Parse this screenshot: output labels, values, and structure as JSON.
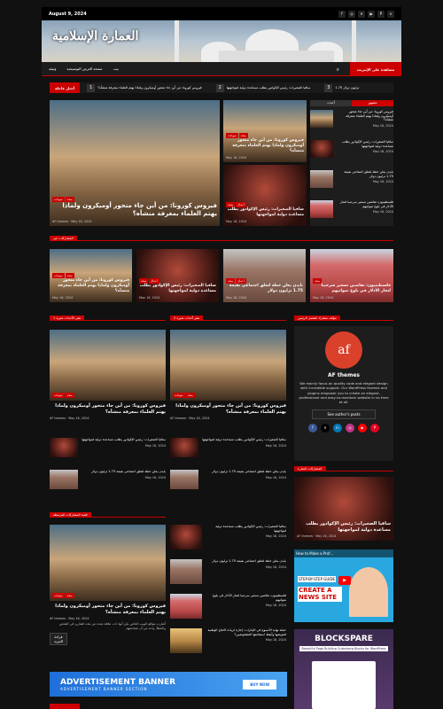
{
  "topbar": {
    "date": "August 9, 2024",
    "social_icons": [
      "facebook-icon",
      "instagram-icon",
      "x-icon",
      "youtube-icon",
      "pinterest-icon",
      "vk-icon"
    ]
  },
  "site": {
    "title": "العمارة الإسلامية"
  },
  "nav": {
    "live_label": "مشاهدة على الإنترنت",
    "items": [
      "بيت",
      "صفحة العرض التوضيحية",
      "وثيقة"
    ]
  },
  "ticker": {
    "label": "أخبار عاجلة",
    "items": [
      {
        "num": "1",
        "text": "فيروس كورونا: من أين جاء متحور أوميكرون ولماذا يهتم العلماء بمعرفة منشأه؟"
      },
      {
        "num": "2",
        "text": "سافيا الصغيرات: رئيس الإكوادور يطلب مساعدة دولية لمواجهتها"
      },
      {
        "num": "3",
        "text": "1.75 ترليون دولار"
      }
    ]
  },
  "hero": {
    "main": {
      "cats": [
        "منوعات",
        "صحة"
      ],
      "title": "فيروس كورونا: من أين جاء متحور أوميكرون ولماذا يهتم العلماء بمعرفة منشأه؟",
      "author": "AF themes",
      "date": "May 16, 2024"
    },
    "side1": {
      "cats": [
        "منوعات",
        "صحة"
      ],
      "title": "فيروس كورونا: من أين جاء متحور أوميكرون ولماذا يهتم العلماء بمعرفة منشأه؟",
      "date": "May 16, 2024"
    },
    "side2": {
      "cats": [
        "صحة",
        "أعمال"
      ],
      "title": "سافيا الصغيرات: رئيس الإكوادور يطلب مساعدة دولية لمواجهتها",
      "date": "May 16, 2024"
    }
  },
  "tabs": {
    "tab1": "مشهور",
    "tab2": "أحدث"
  },
  "tab_list": [
    {
      "title": "فيروس كورونا: من أين جاء متحور أوميكرون ولماذا يهتم العلماء بمعرفة منشأه؟",
      "date": "May 16, 2024"
    },
    {
      "title": "سافيا الصغيرات: رئيس الإكوادور يطلب مساعدة دولية لمواجهتها",
      "date": "May 16, 2024"
    },
    {
      "title": "بايدن يعلن خطة لتغلق اجتماعي بقيمة 1.75 ترليون دولار",
      "date": "May 16, 2024"
    },
    {
      "title": "فلسطينيون: تقاضين تسعير سرحيبا لتجار الأدلار في بلوغ تموانيهم",
      "date": "May 16, 2024"
    }
  ],
  "featured": {
    "heading": "المشاركات عبر",
    "items": [
      {
        "cats": [
          "منوعات",
          "صحة"
        ],
        "title": "فيروس كورونا: من أين جاء متحور أوميكرون ولماذا يهتم العلماء بمعرفة منشأه؟",
        "date": "May 16, 2024"
      },
      {
        "cats": [
          "صحة",
          "أعمال"
        ],
        "title": "سافيا الصغيرات: رئيس الإكوادور يطلب مساعدة دولية لمواجهتها",
        "date": "May 16, 2024"
      },
      {
        "cats": [
          "صحة",
          "أعمال"
        ],
        "title": "بايدن يعلن خطة لتغلق اجتماعي بقيمة 1.75 ترليون دولار",
        "date": "May 16, 2024"
      },
      {
        "cats": [
          "صحة"
        ],
        "title": "فلسطينيون: تقاضين تسعير سرحيبا لتجار الأدلار في بلوغ تموانيهم",
        "date": "May 16, 2024"
      }
    ]
  },
  "col_left": {
    "heading": "نشر الأحداث مثيرة 1",
    "main_title": "فيروس كورونا: من أين جاء متحور أوميكرون ولماذا يهتم العلماء بمعرفة منشأه؟",
    "author": "AF themes",
    "date": "May 16, 2024",
    "list": [
      {
        "title": "سافيا الصغيرات: رئيس الإكوادور يطلب مساعدة دولية لمواجهتها",
        "date": "May 16, 2024"
      },
      {
        "title": "بايدن يعلن خطة لتغلق اجتماعي بقيمة 1.75 ترليون دولار",
        "date": "May 16, 2024"
      }
    ]
  },
  "col_right": {
    "heading": "نشر أحداث مثيرة 2",
    "main_title": "فيروس كورونا: من أين جاء متحور أوميكرون ولماذا يهتم العلماء بمعرفة منشأه؟",
    "author": "AF themes",
    "date": "May 16, 2024",
    "list": [
      {
        "title": "سافيا الصغيرات: رئيس الإكوادور يطلب مساعدة دولية لمواجهتها",
        "date": "May 16, 2024"
      },
      {
        "title": "بايدن يعلن خطة لتغلق اجتماعي بقيمة 1.75 ترليون دولار",
        "date": "May 16, 2024"
      }
    ]
  },
  "author_box": {
    "heading": "مؤلف مشارك للفصل الرئيس",
    "name": "AF themes",
    "bio": "We mainly focus on quality code and elegant design with incredible support. Our WordPress themes and plugins empower you to create an elegant, professional and easy-to-maintain website in no time at all.",
    "button": "See author's posts"
  },
  "featured_side": {
    "heading": "المشاركات المثارة",
    "title": "سافيا الصغيرات: رئيس الإكوادور يطلب مساعدة دولية لمواجهتها",
    "author": "AF themes",
    "date": "May 16, 2024"
  },
  "video": {
    "title": "How to Make a Prof...",
    "line1": "STEP-BY-STEP GUIDE",
    "line2": "CREATE A NEWS SITE"
  },
  "blockspare": {
    "title": "BLOCKSPARE",
    "subtitle": "Beautiful Page Building Gutenberg Blocks for WordPress"
  },
  "col3": {
    "heading": "قصة المشاركات المرتبطة",
    "main_title": "فيروس كورونا: من أين جاء متحور أوميكرون ولماذا يهتم العلماء بمعرفة منشأه؟",
    "author": "AF themes",
    "date": "May 16, 2024",
    "excerpt": "أشارت مواقع الويب الخاص بكن أنها ذات علاقة معدة من هذه التقارير في الفحص والخطأ، واحد من أن شجاعتهم",
    "read_more": "قراءة المزيد"
  },
  "col4": {
    "list": [
      {
        "title": "سافيا الصغيرات: رئيس الإكوادور يطلب مساعدة دولية لمواجهتها",
        "date": "May 16, 2024"
      },
      {
        "title": "بايدن يعلن خطة لتغلق اجتماعي بقيمة 1.75 ترليون دولار",
        "date": "May 16, 2024"
      },
      {
        "title": "فلسطينيون: تقاضين تسعير سرحيبا لتجار الأدلار في بلوغ تموانيهم",
        "date": "May 16, 2024"
      },
      {
        "title": "حملة نهاية الأسبوع في الإمارات: إجازة لزيادة الانتاج الوطنية لتعويضها وأيقظ استقامتها المشغوضين؟",
        "date": "May 16, 2024"
      }
    ]
  },
  "ad": {
    "title": "ADVERTISEMENT BANNER",
    "subtitle": "ADVERTISEMENT BANNER SECTION",
    "button": "BUY NOW"
  }
}
